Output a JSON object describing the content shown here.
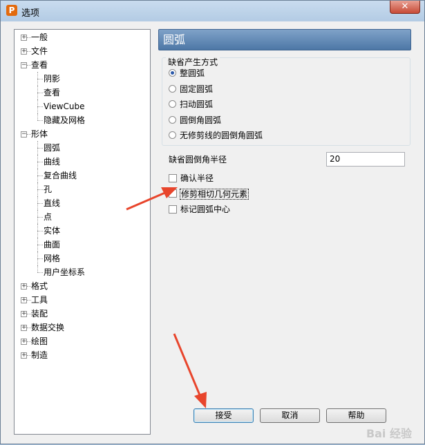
{
  "window": {
    "title": "选项",
    "app_icon": "P",
    "close": "✕"
  },
  "tree": {
    "items": [
      {
        "label": "一般",
        "level": 0,
        "expander": "+"
      },
      {
        "label": "文件",
        "level": 0,
        "expander": "+"
      },
      {
        "label": "查看",
        "level": 0,
        "expander": "−"
      },
      {
        "label": "阴影",
        "level": 1
      },
      {
        "label": "查看",
        "level": 1
      },
      {
        "label": "ViewCube",
        "level": 1
      },
      {
        "label": "隐藏及网格",
        "level": 1
      },
      {
        "label": "形体",
        "level": 0,
        "expander": "−"
      },
      {
        "label": "圆弧",
        "level": 1
      },
      {
        "label": "曲线",
        "level": 1
      },
      {
        "label": "复合曲线",
        "level": 1
      },
      {
        "label": "孔",
        "level": 1
      },
      {
        "label": "直线",
        "level": 1
      },
      {
        "label": "点",
        "level": 1
      },
      {
        "label": "实体",
        "level": 1
      },
      {
        "label": "曲面",
        "level": 1
      },
      {
        "label": "网格",
        "level": 1
      },
      {
        "label": "用户坐标系",
        "level": 1
      },
      {
        "label": "格式",
        "level": 0,
        "expander": "+"
      },
      {
        "label": "工具",
        "level": 0,
        "expander": "+"
      },
      {
        "label": "装配",
        "level": 0,
        "expander": "+"
      },
      {
        "label": "数据交换",
        "level": 0,
        "expander": "+"
      },
      {
        "label": "绘图",
        "level": 0,
        "expander": "+"
      },
      {
        "label": "制造",
        "level": 0,
        "expander": "+"
      }
    ]
  },
  "panel": {
    "title": "圆弧",
    "group_title": "缺省产生方式",
    "radios": [
      {
        "label": "整圆弧",
        "checked": true
      },
      {
        "label": "固定圆弧",
        "checked": false
      },
      {
        "label": "扫动圆弧",
        "checked": false
      },
      {
        "label": "圆倒角圆弧",
        "checked": false
      },
      {
        "label": "无修剪线的圆倒角圆弧",
        "checked": false
      }
    ],
    "radius_label": "缺省圆倒角半径",
    "radius_value": "20",
    "checks": [
      {
        "label": "确认半径",
        "checked": false
      },
      {
        "label": "修剪相切几何元素",
        "checked": false
      },
      {
        "label": "标记圆弧中心",
        "checked": false
      }
    ]
  },
  "buttons": {
    "accept": "接受",
    "cancel": "取消",
    "help": "帮助"
  },
  "watermark": "Bai 经验",
  "colors": {
    "header_bg": "#5a82b0",
    "annotation_arrow": "#e8452c",
    "radio_dot": "#2a58a8"
  }
}
